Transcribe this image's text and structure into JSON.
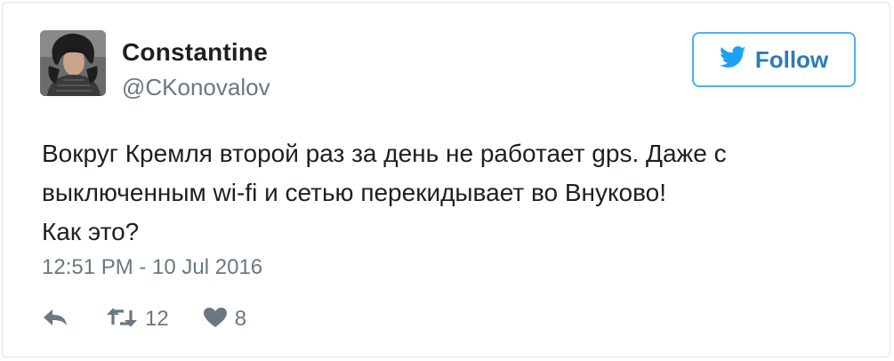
{
  "user": {
    "display_name": "Constantine",
    "handle": "@CKonovalov"
  },
  "follow_button": {
    "label": "Follow",
    "icon": "twitter-bird-icon"
  },
  "tweet": {
    "lines": [
      "Вокруг Кремля второй раз за день не работает gps. Даже с",
      "выключенным wi-fi и сетью перекидывает во Внуково!",
      "Как это?"
    ],
    "timestamp": "12:51 PM - 10 Jul 2016"
  },
  "actions": {
    "reply_icon": "reply-icon",
    "retweet_icon": "retweet-icon",
    "retweet_count": "12",
    "like_icon": "heart-icon",
    "like_count": "8"
  },
  "colors": {
    "text": "#1c2022",
    "secondary": "#697882",
    "accent": "#2b7bb9",
    "follow_border": "#4ab3f4",
    "icon_blue": "#1da1f2"
  }
}
